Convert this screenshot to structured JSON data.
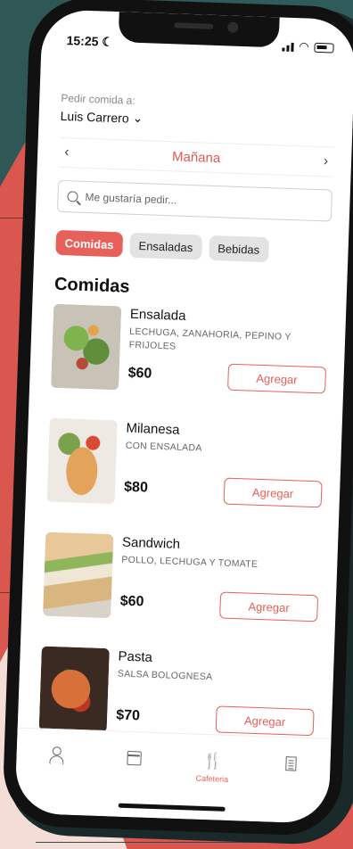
{
  "status_bar": {
    "time": "15:25"
  },
  "header": {
    "deliver_label": "Pedir comida a:",
    "deliver_name": "Luis Carrero"
  },
  "date_nav": {
    "day": "Mañana"
  },
  "search": {
    "placeholder": "Me gustaría pedir..."
  },
  "tabs": [
    {
      "label": "Comidas",
      "active": true
    },
    {
      "label": "Ensaladas",
      "active": false
    },
    {
      "label": "Bebidas",
      "active": false
    }
  ],
  "section": {
    "title": "Comidas"
  },
  "items": [
    {
      "name": "Ensalada",
      "description": "LECHUGA, ZANAHORIA, PEPINO Y FRIJOLES",
      "price": "$60",
      "button": "Agregar",
      "image": "salad"
    },
    {
      "name": "Milanesa",
      "description": "CON ENSALADA",
      "price": "$80",
      "button": "Agregar",
      "image": "milanesa"
    },
    {
      "name": "Sandwich",
      "description": "POLLO, LECHUGA Y TOMATE",
      "price": "$60",
      "button": "Agregar",
      "image": "sandwich"
    },
    {
      "name": "Pasta",
      "description": "SALSA BOLOGNESA",
      "price": "$70",
      "button": "Agregar",
      "image": "pasta"
    }
  ],
  "bottom_nav": [
    {
      "icon": "user-icon",
      "label": ""
    },
    {
      "icon": "calendar-icon",
      "label": ""
    },
    {
      "icon": "cutlery-icon",
      "label": "Cafeteria",
      "active": true
    },
    {
      "icon": "receipt-icon",
      "label": ""
    }
  ],
  "colors": {
    "accent": "#e8605a",
    "teal": "#2f5b5a",
    "coral": "#d9574f"
  }
}
